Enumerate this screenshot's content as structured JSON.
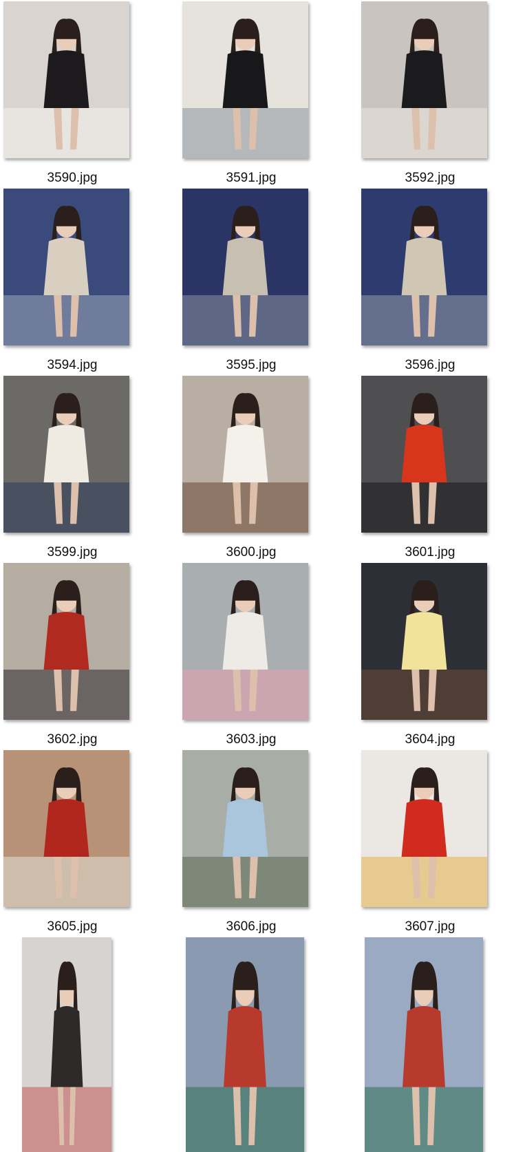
{
  "files": [
    {
      "name": "3590.jpg",
      "bg": "#d9d4cf",
      "fg": "#1c1a1d",
      "accent": "#f4f1ec"
    },
    {
      "name": "3591.jpg",
      "bg": "#e6e2dc",
      "fg": "#18171a",
      "accent": "#8c95a0"
    },
    {
      "name": "3592.jpg",
      "bg": "#c9c4bf",
      "fg": "#1b1a1c",
      "accent": "#e9e5df"
    },
    {
      "name": "3594.jpg",
      "bg": "#3a4a7a",
      "fg": "#d8cfc0",
      "accent": "#9aa6b6"
    },
    {
      "name": "3595.jpg",
      "bg": "#2a3565",
      "fg": "#c7c0b2",
      "accent": "#8892a2"
    },
    {
      "name": "3596.jpg",
      "bg": "#2e3b6e",
      "fg": "#cfc6b4",
      "accent": "#9199a8"
    },
    {
      "name": "3599.jpg",
      "bg": "#6c6a66",
      "fg": "#efeae2",
      "accent": "#2d3a5a"
    },
    {
      "name": "3600.jpg",
      "bg": "#b8aea3",
      "fg": "#f4f1ea",
      "accent": "#6b4a35"
    },
    {
      "name": "3601.jpg",
      "bg": "#4f4f52",
      "fg": "#d8361c",
      "accent": "#1a1a1c"
    },
    {
      "name": "3602.jpg",
      "bg": "#b5aca2",
      "fg": "#b02a20",
      "accent": "#2b2a2f"
    },
    {
      "name": "3603.jpg",
      "bg": "#a9aeb0",
      "fg": "#eeebe6",
      "accent": "#e7a0b0"
    },
    {
      "name": "3604.jpg",
      "bg": "#2c2f35",
      "fg": "#f2e39b",
      "accent": "#6b4a35"
    },
    {
      "name": "3605.jpg",
      "bg": "#b79276",
      "fg": "#b2271d",
      "accent": "#e4e0d9"
    },
    {
      "name": "3606.jpg",
      "bg": "#a8ada6",
      "fg": "#a9c6dd",
      "accent": "#5b6a53"
    },
    {
      "name": "3607.jpg",
      "bg": "#ebe7e2",
      "fg": "#d12a1e",
      "accent": "#e2b24a"
    },
    {
      "name": "",
      "bg": "#d6d4d0",
      "fg": "#2e2a2a",
      "accent": "#c45a5a"
    },
    {
      "name": "",
      "bg": "#8a9ab0",
      "fg": "#b83a2c",
      "accent": "#2f6f55"
    },
    {
      "name": "",
      "bg": "#9aaac2",
      "fg": "#b83a2c",
      "accent": "#2f6f55"
    }
  ]
}
